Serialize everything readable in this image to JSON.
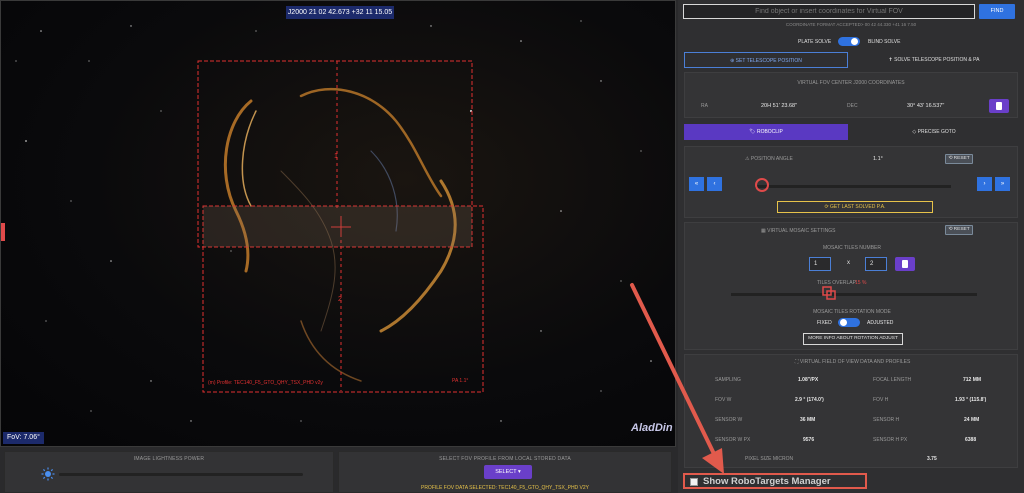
{
  "sky": {
    "coord_banner": "J2000    21 02 42.673 +32 11 15.05",
    "fov_badge": "FoV: 7.06°",
    "logo": "AladDin",
    "tile_label_1": "1",
    "tile_label_2": "2",
    "profile_label": "(m) Profile: TEC140_F5_GTO_QHY_TSX_PHD v2y",
    "pa_label": "PA 1.1°"
  },
  "bottom": {
    "lightness_title": "IMAGE LIGHTNESS POWER",
    "fov_profile_title": "SELECT FOV PROFILE FROM LOCAL STORED DATA",
    "select_button": "SELECT ▾",
    "profile_selected": "PROFILE FOV DATA SELECTED: TEC140_F5_GTO_QHY_TSX_PHD V2Y"
  },
  "side": {
    "search_placeholder": "Find object or insert coordinates for Virtual FOV",
    "find_button": "FIND",
    "coord_format": "COORDINATE FORMAT ACCEPTED> 00 42 44.330 +41 16 7.50",
    "plate_solve": "PLATE SOLVE",
    "blind_solve": "BLIND SOLVE",
    "tab_set_telescope": "⊕ SET TELESCOPE POSITION",
    "tab_solve_telescope": "✝ SOLVE TELESCOPE POSITION & PA",
    "center_title": "VIRTUAL FOV CENTER J2000 COORDINATES",
    "ra_label": "RA",
    "ra_value": "20H 51' 23.68\"",
    "dec_label": "DEC",
    "dec_value": "30° 43' 16.537\"",
    "roboclip": "ROBOCLIP",
    "precise_goto": "PRECISE GOTO",
    "pa_label": "POSITION ANGLE",
    "pa_value": "1.1°",
    "reset": "RESET",
    "nav_left_fast": "«",
    "nav_left": "‹",
    "nav_right": "›",
    "nav_right_fast": "»",
    "get_last_pa": "GET LAST SOLVED P.A.",
    "mosaic_title": "VIRTUAL MOSAIC SETTINGS",
    "tiles_number": "MOSAIC TILES NUMBER",
    "tiles_x": "1",
    "tiles_y": "2",
    "x_sign": "x",
    "tiles_overlap": "TILES OVERLAP",
    "overlap_value": "15 %",
    "rotation_mode": "MOSAIC TILES ROTATION MODE",
    "fixed": "FIXED",
    "adjusted": "ADJUSTED",
    "more_info": "MORE INFO ABOUT ROTATION ADJUST",
    "profile_title": "VIRTUAL FIELD OF VIEW DATA AND PROFILES",
    "rows": [
      {
        "l1": "SAMPLING",
        "v1": "1.08\"/PX",
        "l2": "FOCAL LENGTH",
        "v2": "712 MM"
      },
      {
        "l1": "FOV W",
        "v1": "2.9 ° (174.0')",
        "l2": "FOV H",
        "v2": "1.93 ° (115.8')"
      },
      {
        "l1": "SENSOR W",
        "v1": "36 MM",
        "l2": "SENSOR H",
        "v2": "24 MM"
      },
      {
        "l1": "SENSOR W PX",
        "v1": "9576",
        "l2": "SENSOR H PX",
        "v2": "6388"
      }
    ],
    "pixel_size_label": "PIXEL SIZE MICRON",
    "pixel_size_value": "3.75",
    "robotargets_manager": "Show RoboTargets Manager"
  },
  "colors": {
    "accent_blue": "#2f72e0",
    "accent_purple": "#6a3fc9",
    "overlay_red": "#e03030",
    "warning_yellow": "#e6c24a",
    "annotation_red": "#e15a4c"
  }
}
